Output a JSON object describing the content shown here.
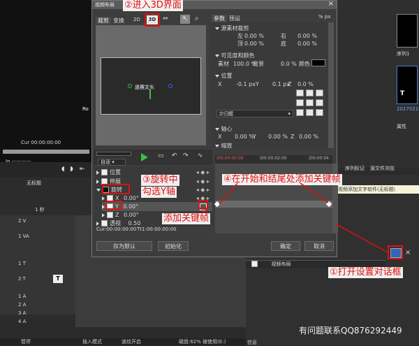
{
  "dialog": {
    "title": "视频布局",
    "close_label": "×",
    "tabs_left": [
      "裁剪",
      "变换"
    ],
    "tabs_right": [
      "参数",
      "预设"
    ],
    "pct_px": "% px",
    "preview_text": "遥赛文头",
    "sections": {
      "source_crop": "源素材裁剪",
      "left": "左",
      "left_val": "0.00 %",
      "right": "右",
      "right_val": "0.00 %",
      "top": "顶",
      "top_val": "0.00 %",
      "bottom": "底",
      "bottom_val": "0.00 %",
      "visibility": "可见度和颜色",
      "material": "素材",
      "material_val": "100.0 %",
      "background": "背景",
      "background_val": "0.0 %",
      "color": "颜色",
      "position": "位置",
      "x": "X",
      "x_val": "-0.1 px",
      "y": "Y",
      "y_val": "0.1 px",
      "z": "Z",
      "z_val": "0.0 %",
      "ruler": "次归鳃",
      "axis": "轴心",
      "ax_x_val": "0.00 %",
      "ax_y_val": "0.00 %",
      "ax_z_val": "0.00 %",
      "more": "缩放"
    },
    "timeline_ruler": [
      "|00:00:00:00",
      "|00:00:02:00",
      "|00:00:04"
    ],
    "mode": "自适",
    "tracks": [
      {
        "label": "位置",
        "expanded": false,
        "checked": false
      },
      {
        "label": "伸展",
        "expanded": false,
        "checked": false
      },
      {
        "label": "旋转",
        "expanded": true,
        "checked": true
      },
      {
        "label": "X",
        "value": "0.00°"
      },
      {
        "label": "Y",
        "value": "0.00°"
      },
      {
        "label": "Z",
        "value": "0.00°"
      },
      {
        "label": "透视",
        "value": "0.50"
      }
    ],
    "cur_time": "Cur:00:00:00:00",
    "total_time": "Tt1:00:00:00:00",
    "btn_save_default": "存为默认",
    "btn_init": "初始化",
    "btn_ok": "确定",
    "btn_cancel": "取消"
  },
  "main": {
    "preview_cur": "Cur 00:00:00:00",
    "preview_in": "In --:--:--:--",
    "timeline_title": "无标题",
    "scale": "1 秒",
    "track_names": [
      "2 V",
      "1 VA",
      "1 T",
      "2 T",
      "1 A",
      "2 A",
      "3 A",
      "4 A"
    ],
    "status": [
      "暂停",
      "插入模式",
      "波纹开启",
      "磁盘:62% 被使用(E:)"
    ],
    "right_panel": {
      "sequence": "序列1",
      "date": "20170218",
      "props": "属性",
      "tab1": "序列标记",
      "tab2": "源文件浏览"
    },
    "info_label": "信息",
    "effect_item": "视频布局",
    "tooltip": "视频添加文字软件(无标题\\"
  },
  "annotations": {
    "a1": "①打开设置对话框",
    "a2": "②进入3D界面",
    "a3_line1": "③旋转中",
    "a3_line2": "勾选Y轴",
    "a4": "④在开始和结尾处添加关键帧",
    "a5": "添加关键帧"
  },
  "footer": "有问题联系QQ876292449",
  "colors": {
    "annotation": "#e01010",
    "accent_green": "#3cc03c",
    "keyframe": "#ffffff"
  }
}
